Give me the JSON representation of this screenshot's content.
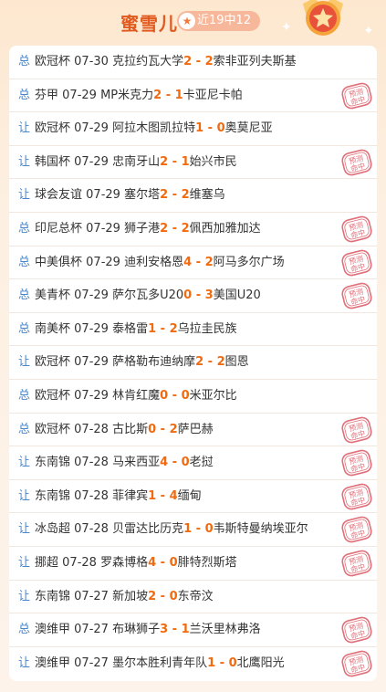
{
  "header": {
    "title": "蜜雪儿",
    "record": "近19中12",
    "star_icon": "star-icon",
    "medal_icon": "medal-star-icon"
  },
  "colors": {
    "accent": "#e15a1f",
    "score": "#f06a10",
    "type": "#4a86c8",
    "stamp": "#e0707a"
  },
  "stamp_label": "预测命中",
  "matches": [
    {
      "type": "总",
      "league": "欧冠杯",
      "date": "07-30",
      "home": "克拉约瓦大学",
      "hs": "2",
      "sep": " - ",
      "as": "2",
      "away": "索非亚列夫斯基",
      "hit": false
    },
    {
      "type": "总",
      "league": "芬甲",
      "date": "07-29",
      "home": "MP米克力",
      "hs": "2",
      "sep": " - ",
      "as": "1",
      "away": "卡亚尼卡帕",
      "hit": true
    },
    {
      "type": "让",
      "league": "欧冠杯",
      "date": "07-29",
      "home": "阿拉木图凯拉特",
      "hs": "1",
      "sep": " - ",
      "as": "0",
      "away": "奥莫尼亚",
      "hit": false
    },
    {
      "type": "让",
      "league": "韩国杯",
      "date": "07-29",
      "home": "忠南牙山",
      "hs": "2",
      "sep": " - ",
      "as": "1",
      "away": "始兴市民",
      "hit": true
    },
    {
      "type": "让",
      "league": "球会友谊",
      "date": "07-29",
      "home": "塞尔塔",
      "hs": "2",
      "sep": " - ",
      "as": "2",
      "away": "维塞乌",
      "hit": false
    },
    {
      "type": "总",
      "league": "印尼总杯",
      "date": "07-29",
      "home": "狮子港",
      "hs": "2",
      "sep": " - ",
      "as": "2",
      "away": "佩西加雅加达",
      "hit": true
    },
    {
      "type": "总",
      "league": "中美俱杯",
      "date": "07-29",
      "home": "迪利安格恩",
      "hs": "4",
      "sep": " - ",
      "as": "2",
      "away": "阿马多尔广场",
      "hit": true
    },
    {
      "type": "总",
      "league": "美青杯",
      "date": "07-29",
      "home": "萨尔瓦多U20",
      "hs": "0",
      "sep": " - ",
      "as": "3",
      "away": "美国U20",
      "hit": true
    },
    {
      "type": "总",
      "league": "南美杯",
      "date": "07-29",
      "home": "泰格雷",
      "hs": "1",
      "sep": " - ",
      "as": "2",
      "away": "乌拉圭民族",
      "hit": false
    },
    {
      "type": "让",
      "league": "欧冠杯",
      "date": "07-29",
      "home": "萨格勒布迪纳摩",
      "hs": "2",
      "sep": " - ",
      "as": "2",
      "away": "图恩",
      "hit": false
    },
    {
      "type": "总",
      "league": "欧冠杯",
      "date": "07-29",
      "home": "林肯红魔",
      "hs": "0",
      "sep": " - ",
      "as": "0",
      "away": "米亚尔比",
      "hit": false
    },
    {
      "type": "总",
      "league": "欧冠杯",
      "date": "07-28",
      "home": "古比斯",
      "hs": "0",
      "sep": " - ",
      "as": "2",
      "away": "萨巴赫",
      "hit": true
    },
    {
      "type": "让",
      "league": "东南锦",
      "date": "07-28",
      "home": "马来西亚",
      "hs": "4",
      "sep": " - ",
      "as": "0",
      "away": "老挝",
      "hit": true
    },
    {
      "type": "让",
      "league": "东南锦",
      "date": "07-28",
      "home": "菲律宾",
      "hs": "1",
      "sep": " - ",
      "as": "4",
      "away": "缅甸",
      "hit": true
    },
    {
      "type": "让",
      "league": "冰岛超",
      "date": "07-28",
      "home": "贝雷达比历克",
      "hs": "1",
      "sep": " - ",
      "as": "0",
      "away": "韦斯特曼纳埃亚尔",
      "hit": true
    },
    {
      "type": "让",
      "league": "挪超",
      "date": "07-28",
      "home": "罗森博格",
      "hs": "4",
      "sep": " - ",
      "as": "0",
      "away": "腓特烈斯塔",
      "hit": true
    },
    {
      "type": "让",
      "league": "东南锦",
      "date": "07-27",
      "home": "新加坡",
      "hs": "2",
      "sep": " - ",
      "as": "0",
      "away": "东帝汶",
      "hit": false
    },
    {
      "type": "总",
      "league": "澳维甲",
      "date": "07-27",
      "home": "布琳狮子",
      "hs": "3",
      "sep": " - ",
      "as": "1",
      "away": "兰沃里林弗洛",
      "hit": true
    },
    {
      "type": "让",
      "league": "澳维甲",
      "date": "07-27",
      "home": "墨尔本胜利青年队",
      "hs": "1",
      "sep": " - ",
      "as": "0",
      "away": "北鹰阳光",
      "hit": true
    }
  ]
}
